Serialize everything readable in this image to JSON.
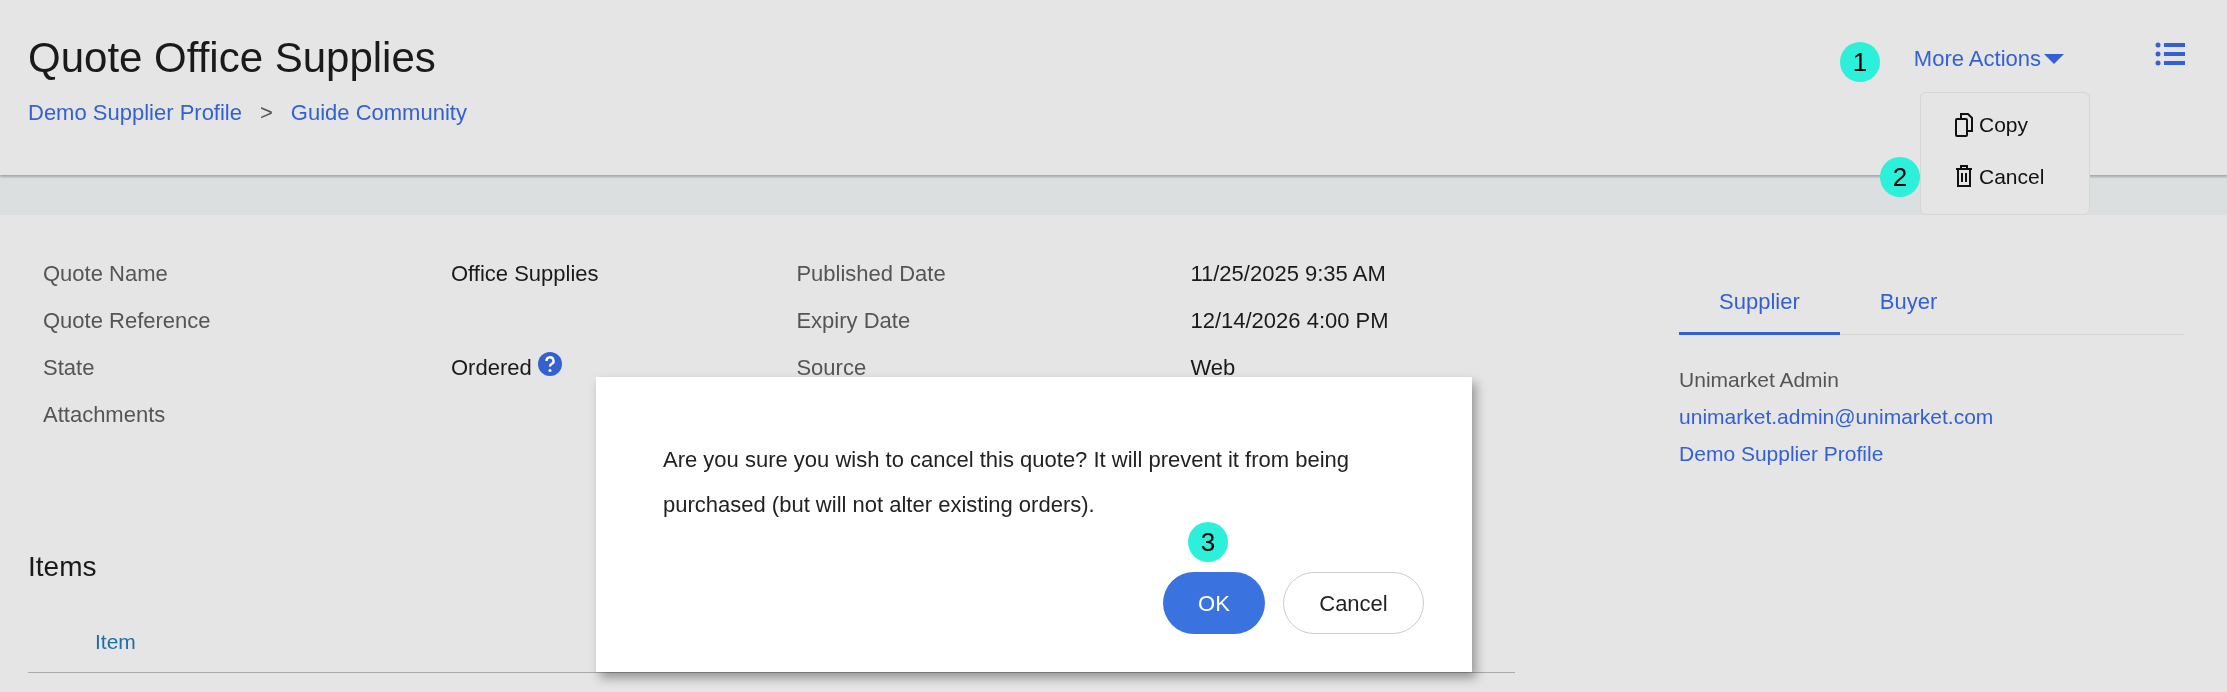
{
  "header": {
    "title": "Quote Office Supplies",
    "breadcrumb": [
      {
        "label": "Demo Supplier Profile"
      },
      {
        "label": "Guide Community"
      }
    ],
    "separator": ">",
    "more_actions": {
      "label": "More Actions",
      "expanded": true
    },
    "menu": [
      {
        "label": "Copy",
        "kind": "copy"
      },
      {
        "label": "Cancel",
        "kind": "delete"
      }
    ]
  },
  "details_left": [
    {
      "label": "Quote Name",
      "value": "Office Supplies",
      "help": false
    },
    {
      "label": "Quote Reference",
      "help": false
    },
    {
      "label": "State",
      "value": "Ordered",
      "help": true
    },
    {
      "label": "Attachments",
      "help": false
    }
  ],
  "details_right": [
    {
      "label": "Published Date",
      "value": "11/25/2025 9:35 AM"
    },
    {
      "label": "Expiry Date",
      "value": "12/14/2026 4:00 PM"
    },
    {
      "label": "Source",
      "value": "Web"
    }
  ],
  "party_tabs": [
    {
      "label": "Supplier",
      "selected": true
    },
    {
      "label": "Buyer",
      "selected": false
    }
  ],
  "contact": {
    "name": "Unimarket Admin",
    "email": "unimarket.admin@unimarket.com",
    "profile": "Demo Supplier Profile"
  },
  "items": {
    "title": "Items",
    "columns": [
      "Item"
    ]
  },
  "dialog": {
    "message": "Are you sure you wish to cancel this quote? It will prevent it from being purchased (but will not alter existing orders).",
    "buttons": [
      {
        "label": "OK",
        "kind": "primary"
      },
      {
        "label": "Cancel",
        "kind": "secondary"
      }
    ]
  },
  "step_markers": [
    "1",
    "2",
    "3"
  ]
}
